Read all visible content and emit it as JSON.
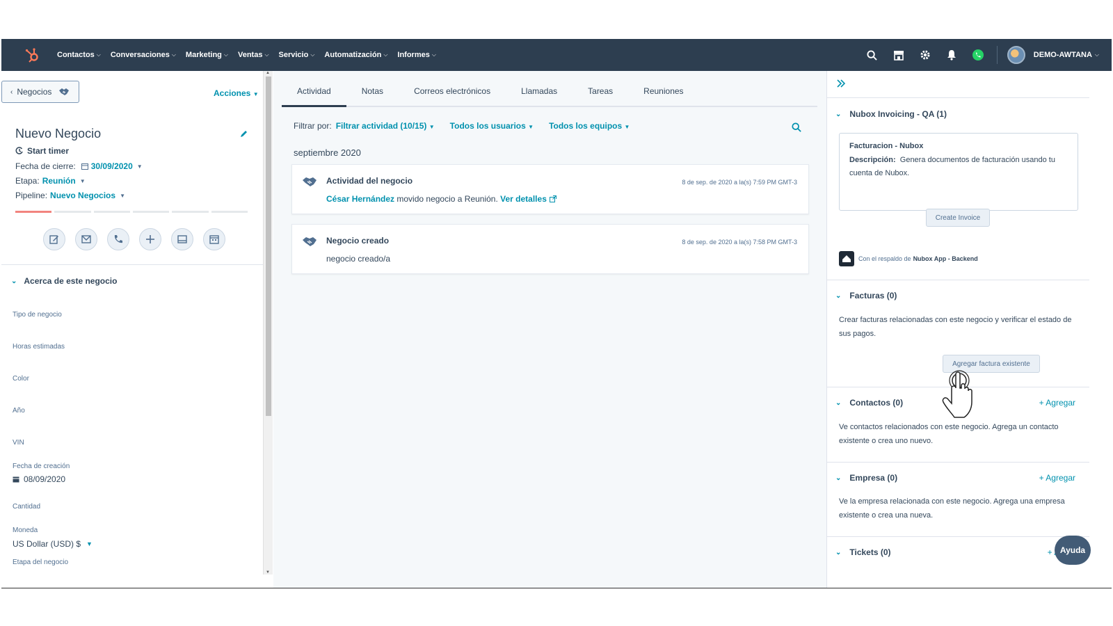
{
  "nav": {
    "items": [
      {
        "label": "Contactos"
      },
      {
        "label": "Conversaciones"
      },
      {
        "label": "Marketing"
      },
      {
        "label": "Ventas"
      },
      {
        "label": "Servicio"
      },
      {
        "label": "Automatización"
      },
      {
        "label": "Informes"
      }
    ],
    "account": "DEMO-AWTANA",
    "colors": {
      "bar": "#2d3e50",
      "accent": "#ff7a59"
    }
  },
  "left": {
    "back_label": "Negocios",
    "actions_label": "Acciones",
    "deal_title": "Nuevo Negocio",
    "timer_label": "Start timer",
    "close_date_label": "Fecha de cierre:",
    "close_date_value": "30/09/2020",
    "stage_label": "Etapa:",
    "stage_value": "Reunión",
    "pipeline_label": "Pipeline:",
    "pipeline_value": "Nuevo Negocios",
    "pipeline_progress": {
      "completed_steps": 1,
      "total_steps": 6
    },
    "about_label": "Acerca de este negocio",
    "fields": {
      "deal_type": "Tipo de negocio",
      "hours": "Horas estimadas",
      "color": "Color",
      "year": "Año",
      "vin": "VIN",
      "created_label": "Fecha de creación",
      "created_value": "08/09/2020",
      "amount": "Cantidad",
      "currency_label": "Moneda",
      "currency_value": "US Dollar (USD) $",
      "deal_stage": "Etapa del negocio"
    }
  },
  "middle": {
    "tabs": [
      {
        "label": "Actividad"
      },
      {
        "label": "Notas"
      },
      {
        "label": "Correos electrónicos"
      },
      {
        "label": "Llamadas"
      },
      {
        "label": "Tareas"
      },
      {
        "label": "Reuniones"
      }
    ],
    "filter_label": "Filtrar por:",
    "filter_activity": "Filtrar actividad (10/15)",
    "filter_users": "Todos los usuarios",
    "filter_teams": "Todos los equipos",
    "month": "septiembre 2020",
    "activities": [
      {
        "title": "Actividad del negocio",
        "time": "8 de sep. de 2020 a la(s) 7:59 PM GMT-3",
        "user": "César Hernández",
        "text": " movido negocio a Reunión. ",
        "link": "Ver detalles"
      },
      {
        "title": "Negocio creado",
        "time": "8 de sep. de 2020 a la(s) 7:58 PM GMT-3",
        "text": "negocio creado/a"
      }
    ]
  },
  "right": {
    "nubox_header": "Nubox Invoicing - QA (1)",
    "invoice_title": "Facturacion - Nubox",
    "desc_label": "Descripción:",
    "desc_text": "Genera documentos de facturación usando tu cuenta de Nubox.",
    "create_invoice": "Create Invoice",
    "backed_by": "Con el respaldo de",
    "backed_app": "Nubox App - Backend",
    "facturas_header": "Facturas (0)",
    "facturas_text": "Crear facturas relacionadas con este negocio y verificar el estado de sus pagos.",
    "add_invoice": "Agregar factura existente",
    "contactos_header": "Contactos (0)",
    "contactos_add": "+ Agregar",
    "contactos_text": "Ve contactos relacionados con este negocio. Agrega un contacto existente o crea uno nuevo.",
    "empresa_header": "Empresa (0)",
    "empresa_add": "+ Agregar",
    "empresa_text": "Ve la empresa relacionada con este negocio. Agrega una empresa existente o crea una nueva.",
    "tickets_header": "Tickets (0)",
    "tickets_add": "+ Ag"
  },
  "help_label": "Ayuda"
}
